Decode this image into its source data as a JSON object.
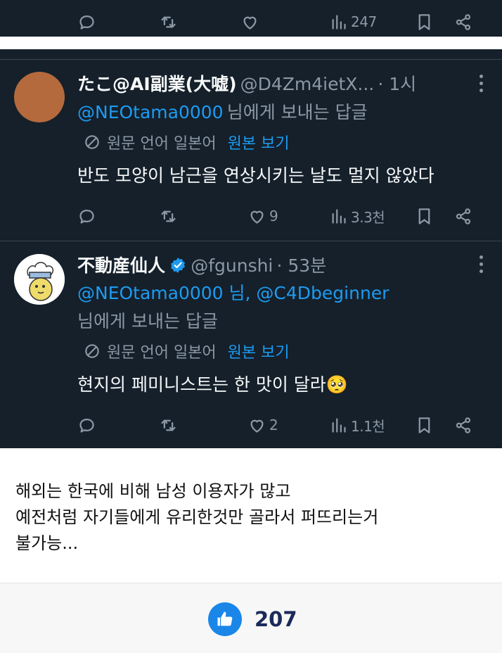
{
  "top_actions": {
    "views": "247"
  },
  "tweets": [
    {
      "name": "たこ@AI副業(大嘘)",
      "handle": "@D4Zm4ietX...",
      "time": "· 1시",
      "mention": "@NEOtama0000",
      "reply_suffix": "님에게 보내는 답글",
      "translation": {
        "label": "원문 언어 일본어",
        "link": "원본 보기"
      },
      "text": "반도 모양이 남근을 연상시키는 날도 멀지 않았다",
      "likes": "9",
      "views": "3.3천",
      "avatar_color": "#b56a3d"
    },
    {
      "name": "不動産仙人",
      "handle": "@fgunshi",
      "time": "· 53분",
      "mention": "@NEOtama0000 님, @C4Dbeginner",
      "reply_suffix": "님에게 보내는 답글",
      "translation": {
        "label": "원문 언어 일본어",
        "link": "원본 보기"
      },
      "text": "현지의 페미니스트는 한 맛이 달라",
      "emoji": "🥺",
      "likes": "2",
      "views": "1.1천",
      "verified_color": "#1d9bf0"
    }
  ],
  "comment": {
    "lines": [
      "해외는 한국에 비해 남성 이용자가 많고",
      "예전처럼 자기들에게 유리한것만 골라서 퍼뜨리는거",
      "불가능..."
    ]
  },
  "like": {
    "count": "207",
    "color": "#1a86e8"
  }
}
